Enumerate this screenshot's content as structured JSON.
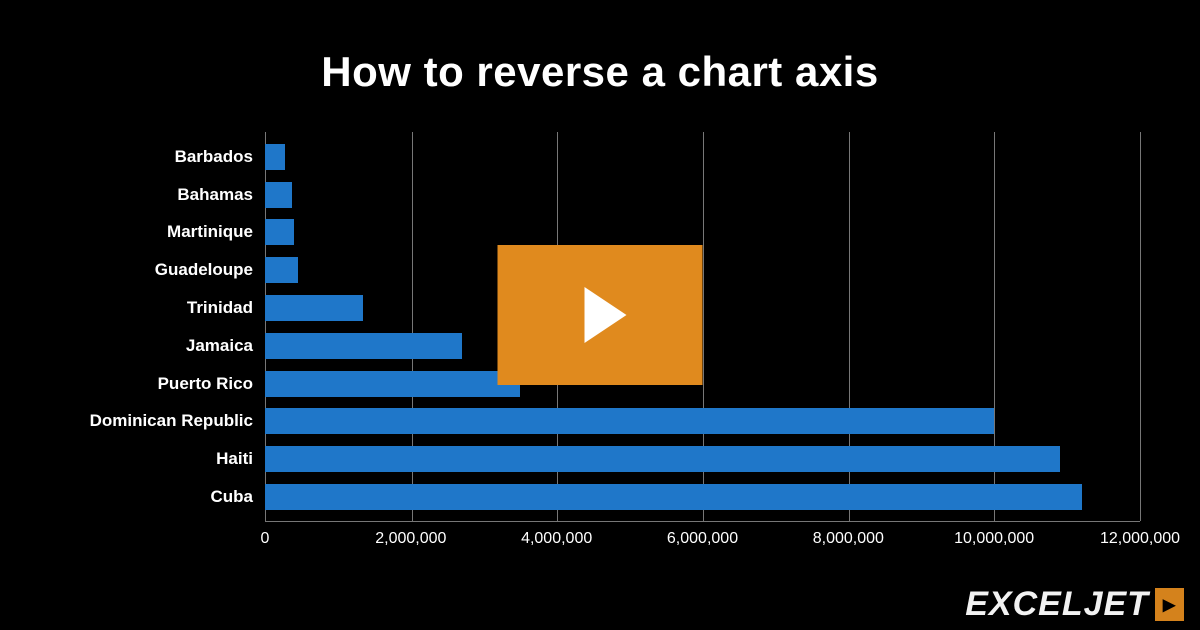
{
  "title": "How to reverse a chart axis",
  "brand": {
    "name": "EXCELJET",
    "badge": "▸"
  },
  "chart_data": {
    "type": "bar",
    "orientation": "horizontal",
    "categories": [
      "Barbados",
      "Bahamas",
      "Martinique",
      "Guadeloupe",
      "Trinidad",
      "Jamaica",
      "Puerto Rico",
      "Dominican Republic",
      "Haiti",
      "Cuba"
    ],
    "values": [
      280000,
      370000,
      400000,
      450000,
      1350000,
      2700000,
      3500000,
      10000000,
      10900000,
      11200000
    ],
    "xlabel": "",
    "ylabel": "",
    "xlim": [
      0,
      12000000
    ],
    "x_ticks": [
      0,
      2000000,
      4000000,
      6000000,
      8000000,
      10000000,
      12000000
    ],
    "x_tick_labels": [
      "0",
      "2,000,000",
      "4,000,000",
      "6,000,000",
      "8,000,000",
      "10,000,000",
      "12,000,000"
    ],
    "grid": true,
    "bar_color": "#1f77c9"
  },
  "play_button": {
    "label": "Play video"
  }
}
